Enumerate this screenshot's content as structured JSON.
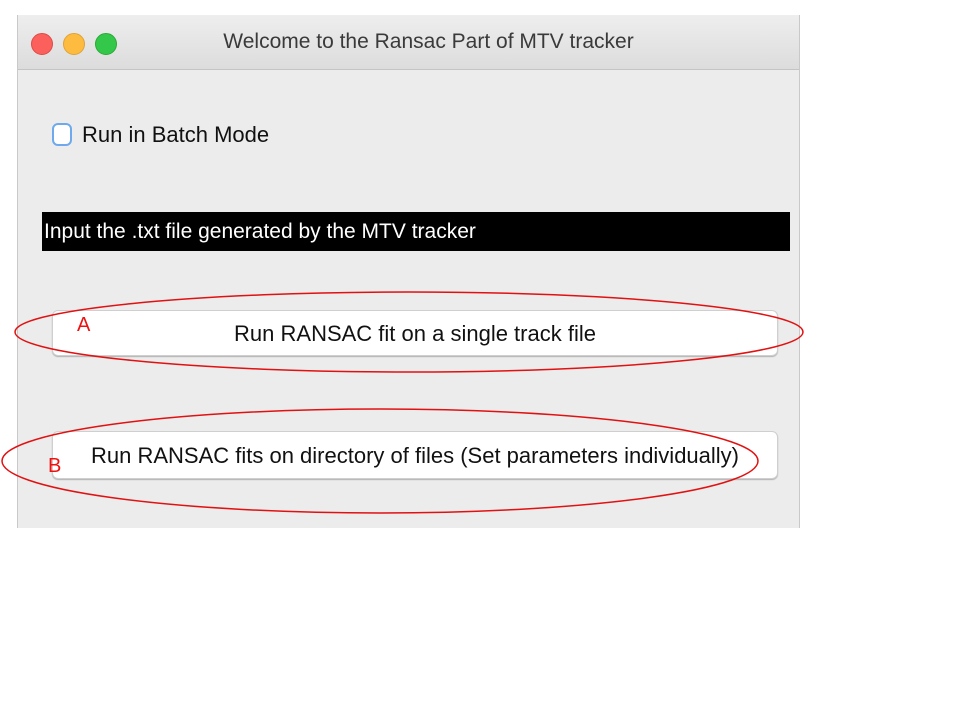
{
  "window": {
    "title": "Welcome to the Ransac Part of MTV tracker"
  },
  "batch_checkbox": {
    "label": "Run in Batch Mode",
    "checked": false
  },
  "info_bar": {
    "text": "Input the .txt file generated by the MTV tracker"
  },
  "buttons": {
    "single": "Run RANSAC fit on a single track file",
    "directory": "Run RANSAC fits on directory of files (Set parameters individually)"
  },
  "annotations": {
    "a": "A",
    "b": "B"
  },
  "colors": {
    "annotation": "#e11111",
    "info_bar_bg": "#000000",
    "close": "#fc605c",
    "minimize": "#fdbc40",
    "zoom": "#34c84a"
  }
}
